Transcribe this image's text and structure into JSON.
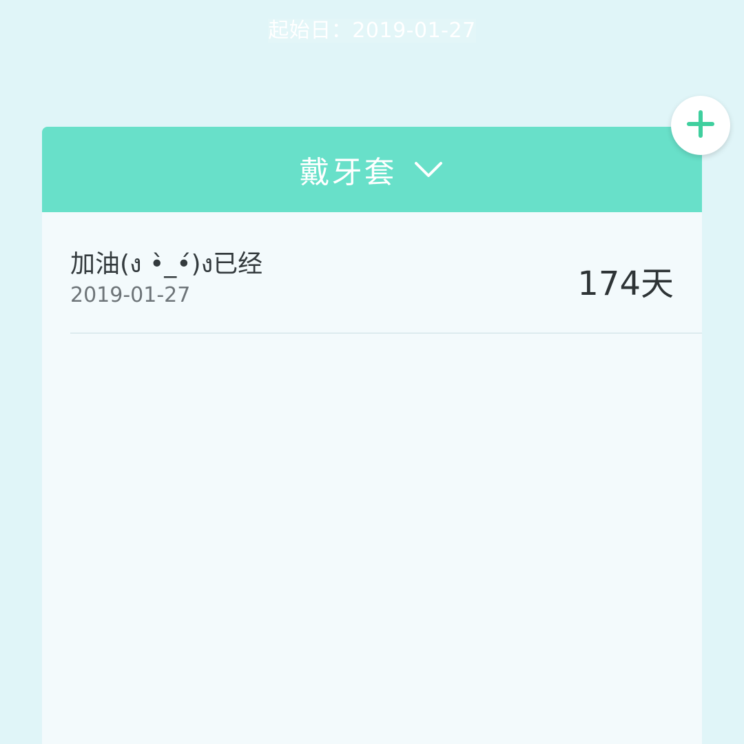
{
  "header": {
    "start_label": "起始日：2019-01-27"
  },
  "card": {
    "title": "戴牙套",
    "dropdown_icon": "chevron-down-icon"
  },
  "records": [
    {
      "label": "加油(ง •̀_•́)ง已经",
      "date": "2019-01-27",
      "days": "174天"
    }
  ],
  "actions": {
    "add_icon": "plus-icon"
  },
  "colors": {
    "background": "#e0f5f8",
    "accent": "#68e0c9",
    "card": "#f3fafc",
    "add_icon": "#3fcf9e"
  }
}
